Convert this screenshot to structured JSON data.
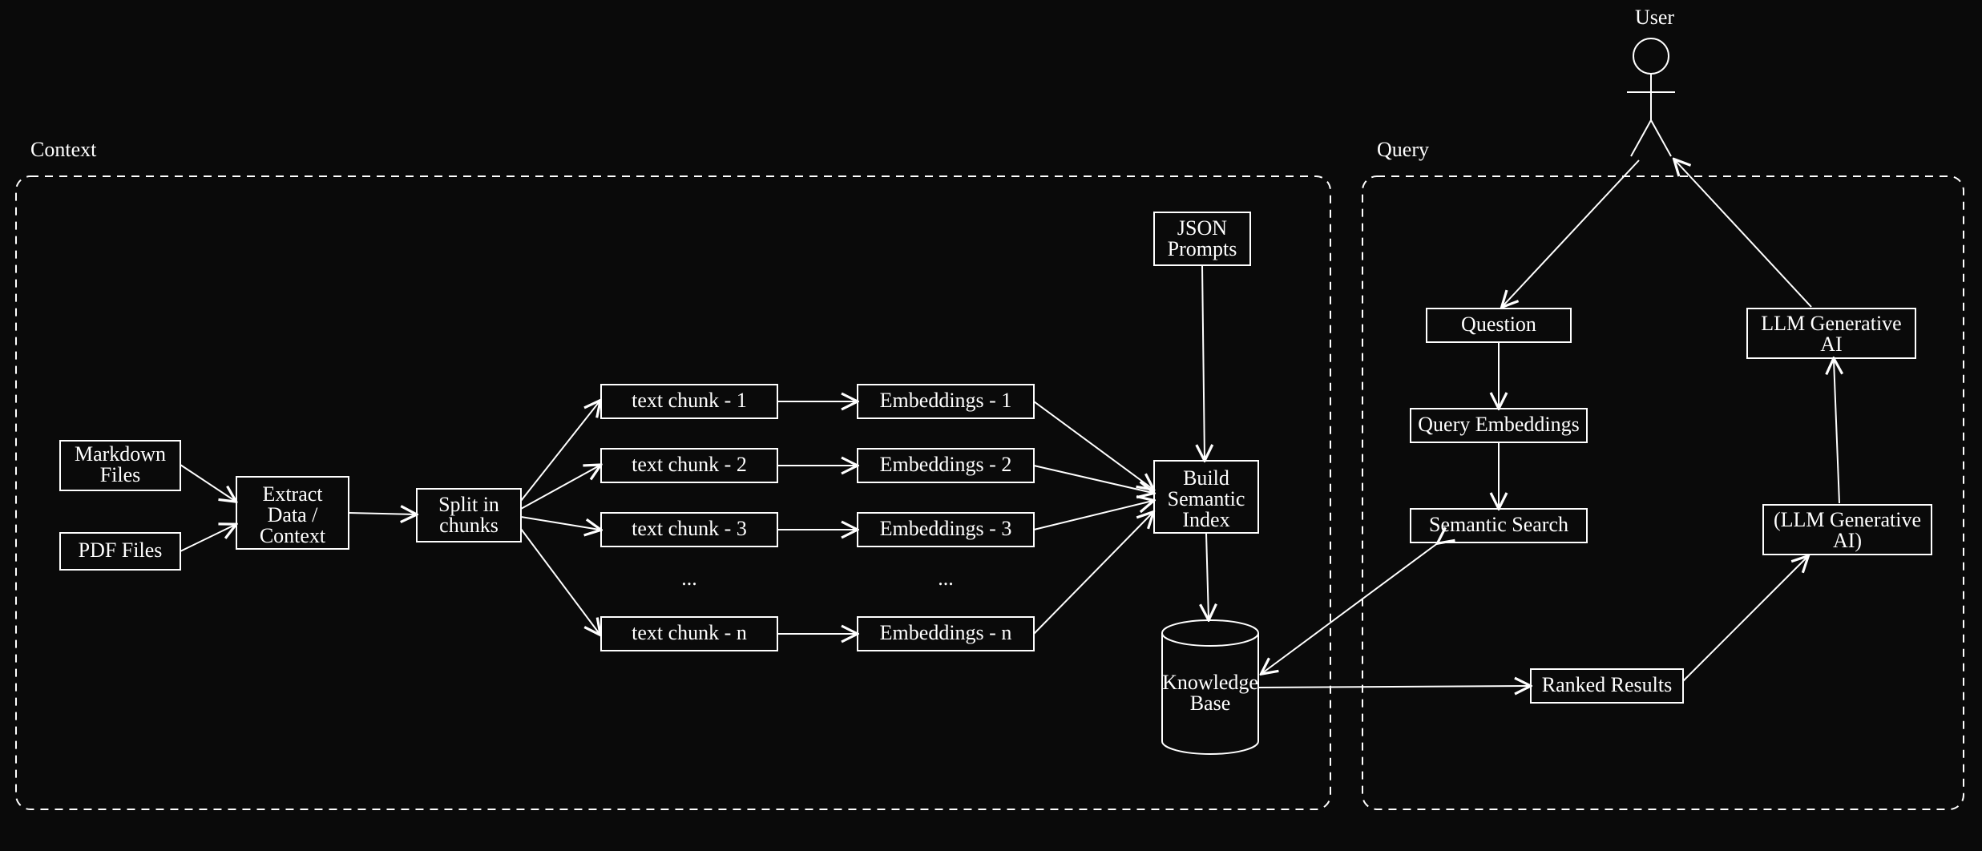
{
  "diagram": {
    "groups": {
      "context": {
        "label": "Context"
      },
      "query": {
        "label": "Query"
      }
    },
    "actors": {
      "user": {
        "label": "User"
      }
    },
    "nodes": {
      "markdown": {
        "label": "Markdown Files"
      },
      "pdf": {
        "label": "PDF Files"
      },
      "extract": {
        "label": "Extract Data / Context"
      },
      "split": {
        "label": "Split in chunks"
      },
      "chunk1": {
        "label": "text chunk - 1"
      },
      "chunk2": {
        "label": "text chunk - 2"
      },
      "chunk3": {
        "label": "text chunk - 3"
      },
      "chunkEll": {
        "label": "..."
      },
      "chunkn": {
        "label": "text chunk - n"
      },
      "emb1": {
        "label": "Embeddings - 1"
      },
      "emb2": {
        "label": "Embeddings - 2"
      },
      "emb3": {
        "label": "Embeddings - 3"
      },
      "embEll": {
        "label": "..."
      },
      "embn": {
        "label": "Embeddings - n"
      },
      "json": {
        "label": "JSON Prompts"
      },
      "build": {
        "label": "Build Semantic Index"
      },
      "kb": {
        "label": "Knowledge Base"
      },
      "question": {
        "label": "Question"
      },
      "qemb": {
        "label": "Query Embeddings"
      },
      "semsearch": {
        "label": "Semantic Search"
      },
      "ranked": {
        "label": "Ranked Results"
      },
      "llmgen2": {
        "label": "(LLM Generative AI)"
      },
      "llmgen": {
        "label": "LLM Generative AI"
      }
    }
  }
}
